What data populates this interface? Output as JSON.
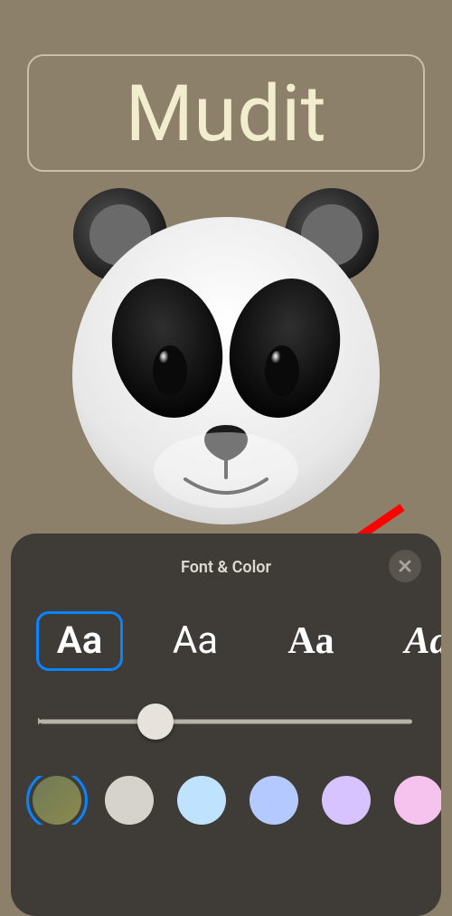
{
  "nameField": {
    "value": "Mudit"
  },
  "panel": {
    "title": "Font & Color",
    "closeIcon": "close-icon",
    "fonts": [
      {
        "sample": "Aa",
        "style": "rounded-bold",
        "selected": true
      },
      {
        "sample": "Aa",
        "style": "sans-regular",
        "selected": false
      },
      {
        "sample": "Aa",
        "style": "serif-bold",
        "selected": false
      },
      {
        "sample": "Aa",
        "style": "serif-italic",
        "selected": false
      }
    ],
    "slider": {
      "value": 0.31,
      "min": 0,
      "max": 1
    },
    "colors": [
      {
        "hex-a": "#6f7a58",
        "hex-b": "#8c8a4c",
        "selected": true
      },
      {
        "hex": "#d6d3cc",
        "selected": false
      },
      {
        "hex": "#bfe2ff",
        "selected": false
      },
      {
        "hex": "#b4c9ff",
        "selected": false
      },
      {
        "hex": "#d6c3ff",
        "selected": false
      },
      {
        "hex": "#f6c3ef",
        "selected": false
      }
    ]
  },
  "annotation": {
    "arrowColor": "#ff0000"
  },
  "avatar": {
    "kind": "memoji-panda"
  }
}
